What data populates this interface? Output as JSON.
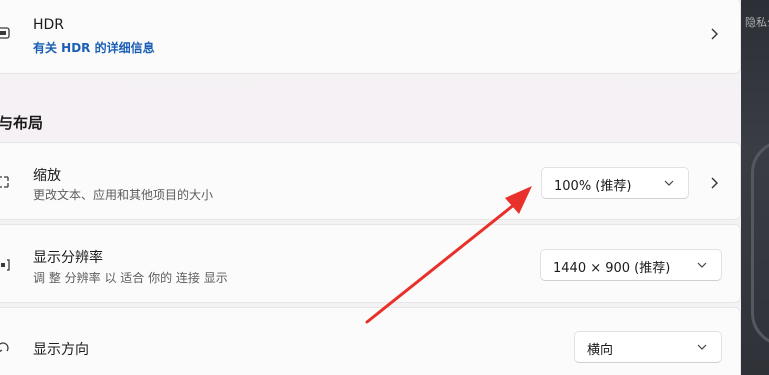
{
  "hdr": {
    "title": "HDR",
    "link": "有关 HDR 的详细信息"
  },
  "section": {
    "title": "与布局"
  },
  "scale": {
    "title": "缩放",
    "desc": "更改文本、应用和其他项目的大小",
    "value": "100% (推荐)"
  },
  "resolution": {
    "title": "显示分辨率",
    "desc": "调 整 分辨率 以 适合 你的 连接 显示",
    "value": "1440 × 900 (推荐)"
  },
  "orientation": {
    "title": "显示方向",
    "value": "横向"
  },
  "background": {
    "ghost_text": "隐私公"
  },
  "colors": {
    "link": "#1a5fb4",
    "annotation_arrow": "#e8312a"
  }
}
